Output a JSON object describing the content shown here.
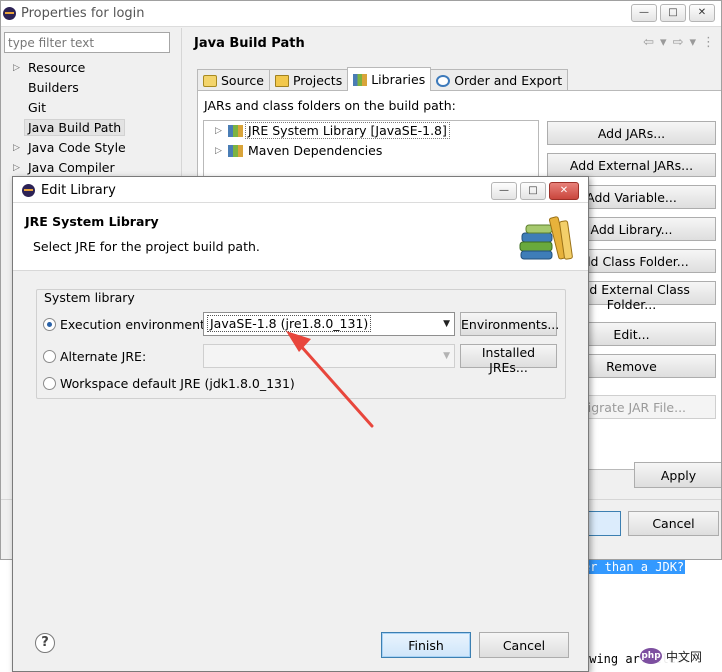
{
  "props_window": {
    "title": "Properties for login",
    "filter_placeholder": "type filter text",
    "nav_items": [
      {
        "label": "Resource",
        "expandable": true
      },
      {
        "label": "Builders",
        "expandable": false
      },
      {
        "label": "Git",
        "expandable": false
      },
      {
        "label": "Java Build Path",
        "expandable": false,
        "selected": true
      },
      {
        "label": "Java Code Style",
        "expandable": true
      },
      {
        "label": "Java Compiler",
        "expandable": true
      }
    ],
    "page_title": "Java Build Path",
    "tabs": [
      {
        "label": "Source",
        "icon": "source-folder-icon"
      },
      {
        "label": "Projects",
        "icon": "projects-icon"
      },
      {
        "label": "Libraries",
        "icon": "libraries-icon",
        "active": true
      },
      {
        "label": "Order and Export",
        "icon": "order-export-icon"
      }
    ],
    "tab_description": "JARs and class folders on the build path:",
    "libraries": [
      {
        "label": "JRE System Library [JavaSE-1.8]",
        "selected": true
      },
      {
        "label": "Maven Dependencies"
      }
    ],
    "side_buttons": [
      {
        "label": "Add JARs..."
      },
      {
        "label": "Add External JARs..."
      },
      {
        "label": "Add Variable..."
      },
      {
        "label": "Add Library..."
      },
      {
        "label": "Add Class Folder..."
      },
      {
        "label": "Add External Class Folder..."
      },
      {
        "label": "Edit..."
      },
      {
        "label": "Remove"
      },
      {
        "label": "Migrate JAR File...",
        "disabled": true
      }
    ],
    "apply_label": "Apply",
    "cancel_label": "Cancel"
  },
  "editor_snippets": {
    "highlighted": "er than a JDK?",
    "plain": "owing articles:"
  },
  "watermark": {
    "logo_text": "php",
    "text": "中文网"
  },
  "dialog": {
    "title": "Edit Library",
    "header_title": "JRE System Library",
    "header_desc": "Select JRE for the project build path.",
    "group_label": "System library",
    "exec_env_label": "Execution environment:",
    "exec_env_value": "JavaSE-1.8 (jre1.8.0_131)",
    "environments_button": "Environments...",
    "alt_jre_label": "Alternate JRE:",
    "alt_jre_value": "",
    "installed_jres_button": "Installed JREs...",
    "workspace_default_label": "Workspace default JRE (jdk1.8.0_131)",
    "finish_label": "Finish",
    "cancel_label": "Cancel",
    "help_glyph": "?"
  },
  "colors": {
    "annotation_arrow": "#e8463c",
    "selection_highlight": "#3399ff",
    "default_button_border": "#3c7fb1"
  }
}
